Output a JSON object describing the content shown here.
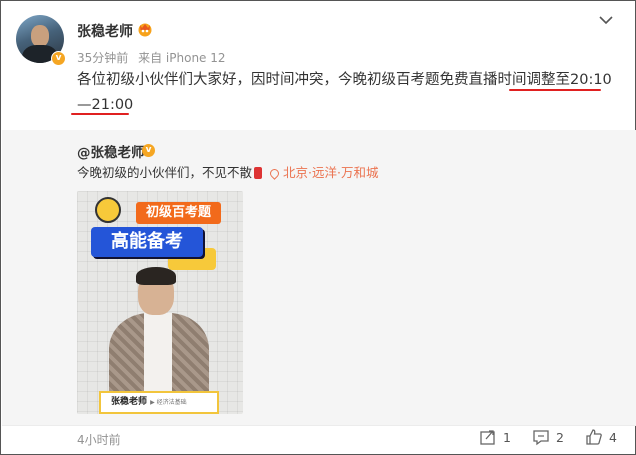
{
  "post": {
    "author": "张稳老师",
    "time": "35分钟前",
    "source": "来自 iPhone 12",
    "text": "各位初级小伙伴们大家好，因时间冲突，今晚初级百考题免费直播时间调整至20:10—21:00"
  },
  "repost": {
    "author": "@张稳老师",
    "text": "今晚初级的小伙伴们，不见不散",
    "location": "北京·远洋·万和城",
    "poster": {
      "title_top": "初级百考题",
      "title_main": "高能备考",
      "nameplate_name": "张稳老师",
      "nameplate_sub": "▶ 经济法基础"
    }
  },
  "footer": {
    "time": "4小时前",
    "share_count": "1",
    "comment_count": "2",
    "like_count": "4"
  },
  "colors": {
    "highlight_underline": "#e02020",
    "location": "#eb7350",
    "verify_badge": "#f5a623"
  },
  "icons": [
    "chevron-down-icon",
    "verified-icon",
    "vip-badge-icon",
    "location-pin-icon",
    "share-icon",
    "comment-icon",
    "like-icon"
  ]
}
